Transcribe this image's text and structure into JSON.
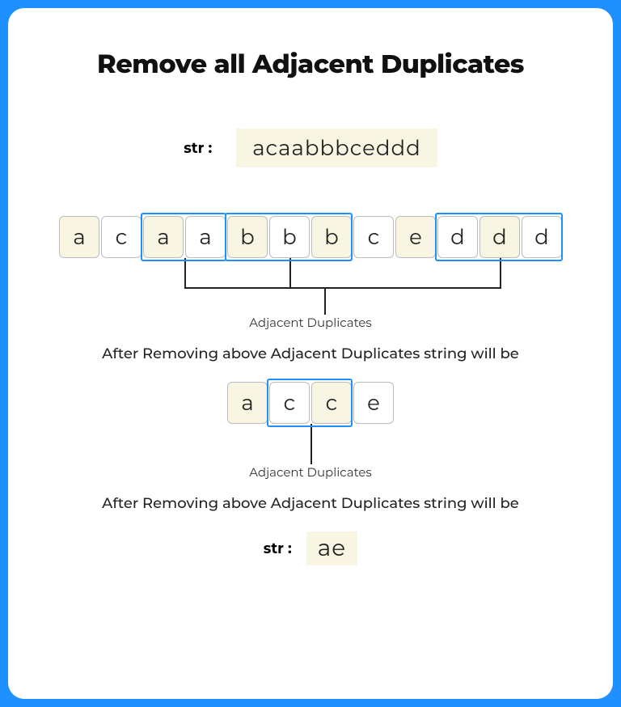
{
  "title": "Remove all Adjacent Duplicates",
  "input": {
    "label": "str :",
    "value": "acaabbbceddd"
  },
  "row1": {
    "cells": [
      {
        "ch": "a",
        "shade": true
      },
      {
        "ch": "c",
        "shade": false
      },
      {
        "ch": "a",
        "shade": true
      },
      {
        "ch": "a",
        "shade": false
      },
      {
        "ch": "b",
        "shade": true
      },
      {
        "ch": "b",
        "shade": false
      },
      {
        "ch": "b",
        "shade": true
      },
      {
        "ch": "c",
        "shade": false
      },
      {
        "ch": "e",
        "shade": true
      },
      {
        "ch": "d",
        "shade": false
      },
      {
        "ch": "d",
        "shade": true
      },
      {
        "ch": "d",
        "shade": false
      }
    ],
    "groups": [
      {
        "start": 2,
        "end": 3
      },
      {
        "start": 4,
        "end": 6
      },
      {
        "start": 9,
        "end": 11
      }
    ],
    "label": "Adjacent Duplicates"
  },
  "caption1": "After Removing above Adjacent Duplicates string will be",
  "row2": {
    "cells": [
      {
        "ch": "a",
        "shade": true
      },
      {
        "ch": "c",
        "shade": false
      },
      {
        "ch": "c",
        "shade": true
      },
      {
        "ch": "e",
        "shade": false
      }
    ],
    "groups": [
      {
        "start": 1,
        "end": 2
      }
    ],
    "label": "Adjacent Duplicates"
  },
  "caption2": "After Removing above Adjacent Duplicates string will be",
  "output": {
    "label": "str :",
    "value": "ae"
  }
}
